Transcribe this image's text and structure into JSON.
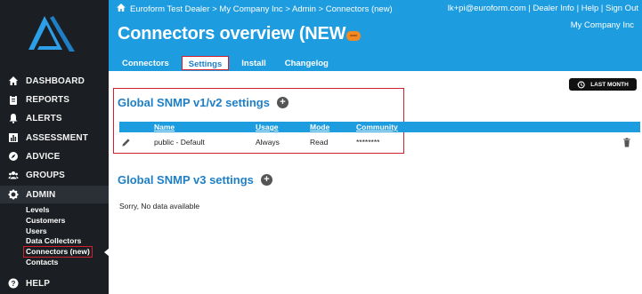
{
  "sidebar": {
    "items": [
      {
        "label": "DASHBOARD",
        "icon": "home-icon"
      },
      {
        "label": "REPORTS",
        "icon": "clipboard-icon"
      },
      {
        "label": "ALERTS",
        "icon": "bell-icon"
      },
      {
        "label": "ASSESSMENT",
        "icon": "bar-chart-icon"
      },
      {
        "label": "ADVICE",
        "icon": "compass-icon"
      },
      {
        "label": "GROUPS",
        "icon": "group-icon"
      },
      {
        "label": "ADMIN",
        "icon": "gear-icon"
      },
      {
        "label": "HELP",
        "icon": "question-icon"
      }
    ],
    "admin_sub": [
      "Levels",
      "Customers",
      "Users",
      "Data Collectors",
      "Connectors (new)",
      "Contacts"
    ]
  },
  "header": {
    "breadcrumb": "Euroform Test Dealer > My Company Inc > Admin > Connectors (new)",
    "user_email": "lk+pi@euroform.com",
    "sep1": "|",
    "dealer_info": "Dealer Info",
    "sep2": "|",
    "help": "Help",
    "sep3": "|",
    "sign_out": "Sign Out",
    "company": "My Company Inc",
    "title": "Connectors overview (NEW"
  },
  "tabs": [
    "Connectors",
    "Settings",
    "Install",
    "Changelog"
  ],
  "active_tab": "Settings",
  "content": {
    "last_month": "LAST MONTH",
    "snmp_v12_title": "Global SNMP v1/v2 settings",
    "columns": [
      "Name",
      "Usage",
      "Mode",
      "Community"
    ],
    "rows": [
      {
        "name": "public - Default",
        "usage": "Always",
        "mode": "Read",
        "community": "********"
      }
    ],
    "snmp_v3_title": "Global SNMP v3 settings",
    "no_data": "Sorry, No data available"
  },
  "colors": {
    "header": "#1e9ce0",
    "sidebar": "#1b1e22",
    "accent": "#1e7fc6",
    "highlight": "#d0202e"
  }
}
